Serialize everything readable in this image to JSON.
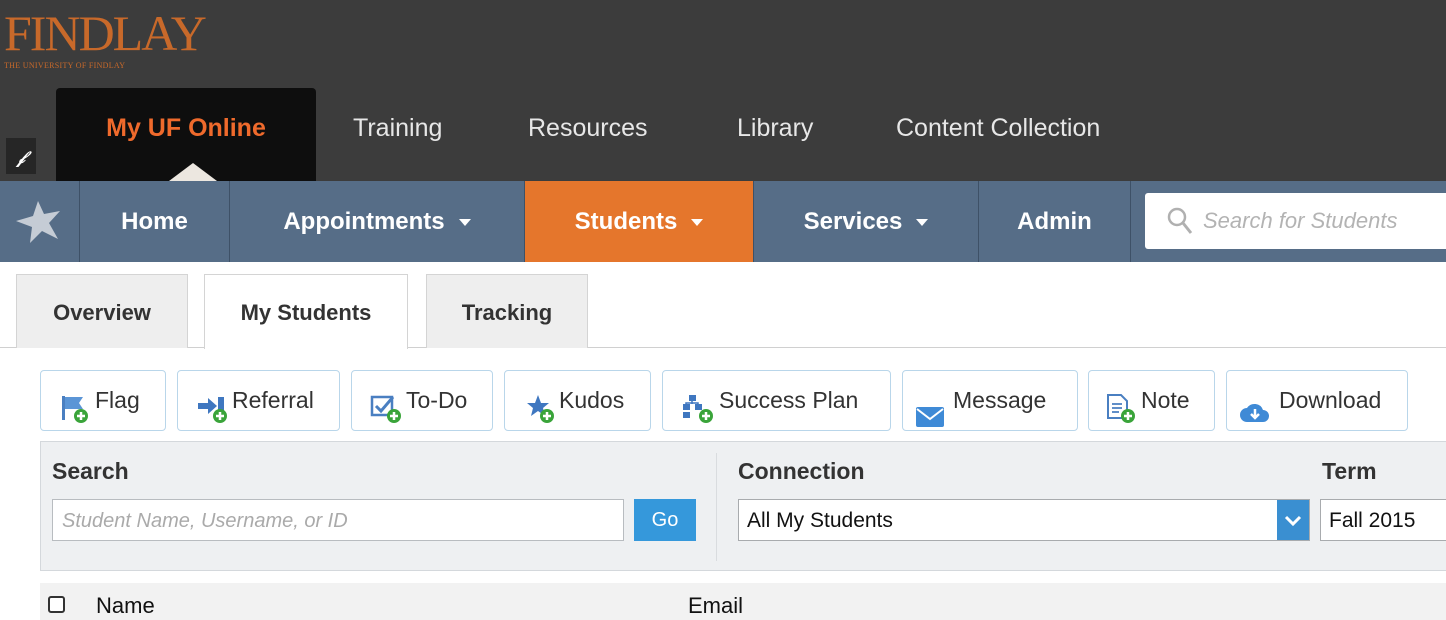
{
  "brand": {
    "name": "FINDLAY",
    "subtitle": "THE UNIVERSITY OF FINDLAY",
    "color": "#c8692a"
  },
  "top_tabs": [
    {
      "label": "My UF Online",
      "active": true
    },
    {
      "label": "Training"
    },
    {
      "label": "Resources"
    },
    {
      "label": "Library"
    },
    {
      "label": "Content Collection"
    }
  ],
  "nav": {
    "items": [
      {
        "label": "Home"
      },
      {
        "label": "Appointments",
        "dropdown": true
      },
      {
        "label": "Students",
        "dropdown": true,
        "active": true
      },
      {
        "label": "Services",
        "dropdown": true
      },
      {
        "label": "Admin"
      }
    ],
    "search_placeholder": "Search for Students",
    "active_color": "#e5762c",
    "bar_color": "#566d87"
  },
  "sub_tabs": [
    {
      "label": "Overview"
    },
    {
      "label": "My Students",
      "active": true
    },
    {
      "label": "Tracking"
    }
  ],
  "actions": [
    {
      "label": "Flag",
      "icon": "flag-add-icon"
    },
    {
      "label": "Referral",
      "icon": "referral-add-icon"
    },
    {
      "label": "To-Do",
      "icon": "todo-add-icon"
    },
    {
      "label": "Kudos",
      "icon": "kudos-add-icon"
    },
    {
      "label": "Success Plan",
      "icon": "success-plan-add-icon"
    },
    {
      "label": "Message",
      "icon": "envelope-icon"
    },
    {
      "label": "Note",
      "icon": "note-add-icon"
    },
    {
      "label": "Download",
      "icon": "cloud-download-icon"
    }
  ],
  "filters": {
    "search_label": "Search",
    "search_placeholder": "Student Name, Username, or ID",
    "go_label": "Go",
    "connection_label": "Connection",
    "connection_value": "All My Students",
    "term_label": "Term",
    "term_value": "Fall 2015"
  },
  "table": {
    "columns": [
      "Name",
      "Email"
    ]
  }
}
